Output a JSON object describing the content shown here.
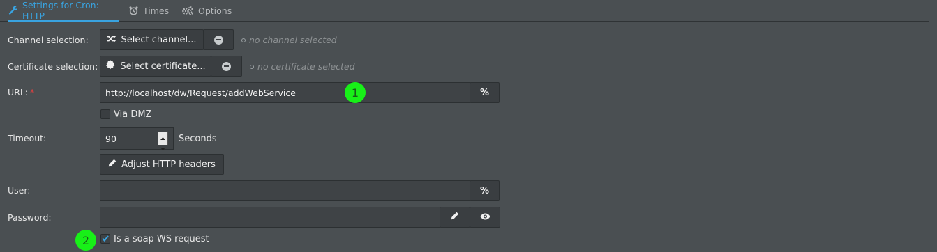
{
  "tabs": [
    {
      "label": "Settings for Cron: HTTP",
      "icon": "wrench-icon"
    },
    {
      "label": "Times",
      "icon": "alarm-clock-icon"
    },
    {
      "label": "Options",
      "icon": "gears-icon"
    }
  ],
  "channel": {
    "label": "Channel selection:",
    "button": "Select channel...",
    "status": "no channel selected"
  },
  "certificate": {
    "label": "Certificate selection:",
    "button": "Select certificate...",
    "status": "no certificate selected"
  },
  "url": {
    "label": "URL:",
    "required_mark": "*",
    "value": "http://localhost/dw/Request/addWebService",
    "placeholder_button": "%"
  },
  "via_dmz": {
    "label": "Via DMZ",
    "checked": false
  },
  "timeout": {
    "label": "Timeout:",
    "value": "90",
    "unit": "Seconds"
  },
  "headers_button": "Adjust HTTP headers",
  "user": {
    "label": "User:",
    "value": "",
    "placeholder_button": "%"
  },
  "password": {
    "label": "Password:",
    "value": ""
  },
  "soap": {
    "label": "Is a soap WS request",
    "checked": true
  },
  "markers": [
    "1",
    "2"
  ],
  "colors": {
    "accent": "#39a3e0",
    "marker": "#18f018",
    "required": "#e04040",
    "background": "#4a4f52"
  }
}
